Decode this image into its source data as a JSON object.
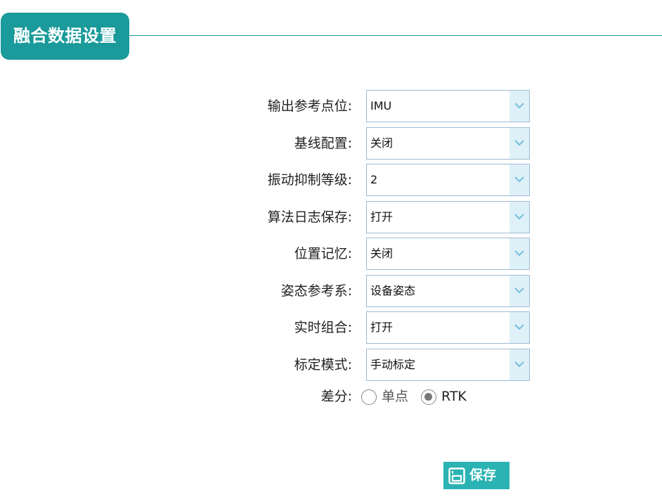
{
  "header": {
    "title": "融合数据设置"
  },
  "form": {
    "fields": [
      {
        "label": "输出参考点位:",
        "value": "IMU"
      },
      {
        "label": "基线配置:",
        "value": "关闭"
      },
      {
        "label": "振动抑制等级:",
        "value": "2"
      },
      {
        "label": "算法日志保存:",
        "value": "打开"
      },
      {
        "label": "位置记忆:",
        "value": "关闭"
      },
      {
        "label": "姿态参考系:",
        "value": "设备姿态"
      },
      {
        "label": "实时组合:",
        "value": "打开"
      },
      {
        "label": "标定模式:",
        "value": "手动标定"
      }
    ],
    "differential": {
      "label": "差分:",
      "options": [
        "单点",
        "RTK"
      ],
      "selected": "RTK"
    }
  },
  "actions": {
    "save_label": "保存"
  },
  "colors": {
    "accent": "#1a9a9a",
    "button": "#2bb3b3",
    "select_border": "#9fbbd3",
    "select_arrow_bg": "#dff1f8",
    "arrow": "#7cc0e0"
  },
  "icons": {
    "select_arrow": "chevron-down-icon",
    "save": "save-icon"
  }
}
